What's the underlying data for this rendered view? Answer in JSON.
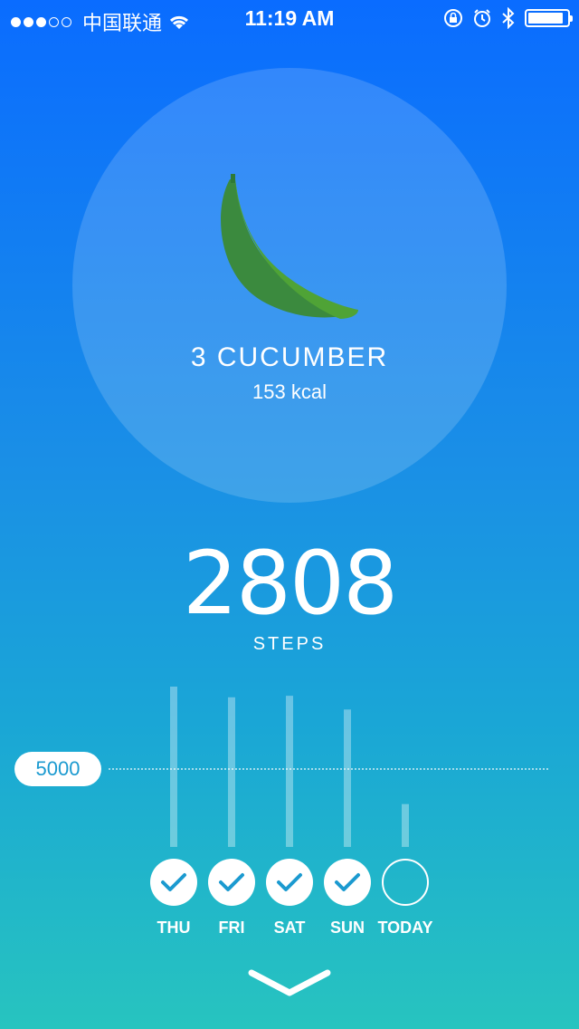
{
  "status_bar": {
    "carrier": "中国联通",
    "time": "11:19 AM",
    "battery_level": 0.9
  },
  "food": {
    "name": "3 CUCUMBER",
    "kcal": "153 kcal",
    "icon": "cucumber-icon",
    "icon_colors": {
      "dark": "#3b8a3e",
      "light": "#4fa336",
      "stem": "#2f7a36"
    }
  },
  "steps": {
    "count": "2808",
    "label": "STEPS",
    "goal": "5000"
  },
  "chart_data": {
    "type": "bar",
    "categories": [
      "THU",
      "FRI",
      "SAT",
      "SUN",
      "TODAY"
    ],
    "values": [
      10500,
      9800,
      9900,
      9000,
      2808
    ],
    "goal": 5000,
    "ylim": [
      0,
      10500
    ],
    "completed": [
      true,
      true,
      true,
      true,
      false
    ]
  },
  "colors": {
    "gradient_top": "#0a6cff",
    "gradient_bottom": "#27c4bf",
    "check_color": "#1b9ad0"
  }
}
